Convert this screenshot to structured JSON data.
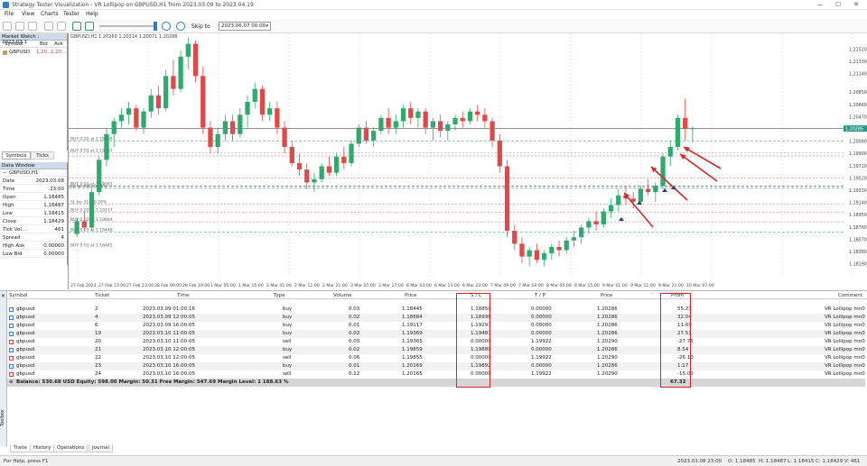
{
  "window": {
    "title": "Strategy Tester Visualization - VR Lollipop on GBPUSD,H1 from 2023.03.09 to 2023.04.19",
    "minimize": "—",
    "maximize": "☐",
    "close": "✕"
  },
  "menu": [
    "File",
    "View",
    "Charts",
    "Tester",
    "Help"
  ],
  "toolbar": {
    "skip_to_label": "Skip to",
    "skip_to_value": "2023.06.07 00:00"
  },
  "market_watch": {
    "title": "Market Watch : 2023.03.1",
    "columns": [
      "Symbol",
      "Bid",
      "Ask"
    ],
    "rows": [
      {
        "symbol": "GBPUSD",
        "bid": "1.20...",
        "ask": "1.20..."
      }
    ],
    "tabs": [
      "Symbols",
      "Ticks"
    ]
  },
  "data_window": {
    "title": "Data Window",
    "symbol": "GBPUSD,H1",
    "rows": [
      {
        "label": "Date",
        "value": "2023.03.08"
      },
      {
        "label": "Time",
        "value": "23:00"
      },
      {
        "label": "Open",
        "value": "1.18485"
      },
      {
        "label": "High",
        "value": "1.18487"
      },
      {
        "label": "Low",
        "value": "1.18415"
      },
      {
        "label": "Close",
        "value": "1.18429"
      },
      {
        "label": "Tick Vol...",
        "value": "461"
      },
      {
        "label": "Spread",
        "value": "4"
      },
      {
        "label": "High Ask",
        "value": "0.00000"
      },
      {
        "label": "Low Bid",
        "value": "0.00000"
      }
    ]
  },
  "chart": {
    "header": "GBPUSD,H1  1.20260 1.20314 1.20071 1.20286",
    "price_labels": [
      "1.21520",
      "1.21330",
      "1.21140",
      "1.20850",
      "1.20660",
      "1.20470",
      "1.20280",
      "1.20090",
      "1.19900",
      "1.19710",
      "1.19520",
      "1.19330",
      "1.19140",
      "1.18950",
      "1.18760",
      "1.18570",
      "1.18380",
      "1.18190"
    ],
    "current_price": "1.20286",
    "time_labels": [
      "27 Feb 2023",
      "27 Feb 13:00",
      "27 Feb 23:00",
      "28 Feb 09:00",
      "28 Feb 19:00",
      "1 Mar 05:00",
      "1 Mar 15:00",
      "2 Mar 01:00",
      "2 Mar 11:00",
      "2 Mar 21:00",
      "3 Mar 07:00",
      "3 Mar 17:00",
      "6 Mar 03:00",
      "6 Mar 13:00",
      "6 Mar 23:00",
      "7 Mar 09:00",
      "7 Mar 19:00",
      "8 Mar 05:00",
      "8 Mar 15:00",
      "9 Mar 01:00",
      "9 Mar 11:00",
      "9 Mar 21:00",
      "10 Mar 07:00"
    ],
    "order_labels": [
      "BUY 0.03 at 1.18448",
      "BUY 0.02 at 1.18998",
      "BUY 0.01 at 1.19297",
      "BUY 0.01 at 1.19361",
      "SL for 405, 0.34%",
      "SL for 314, 0.26%",
      "BUY 0.02 at 1.19117",
      "BUY 0.02 at 1.18684",
      "BUY 0.03 at 1.18445"
    ],
    "candles": [
      [
        1.1865,
        1.189,
        1.186,
        1.1885
      ],
      [
        1.1885,
        1.19,
        1.187,
        1.1875
      ],
      [
        1.1875,
        1.1935,
        1.187,
        1.193
      ],
      [
        1.193,
        1.1985,
        1.1925,
        1.198
      ],
      [
        1.198,
        1.203,
        1.197,
        1.202
      ],
      [
        1.202,
        1.2045,
        1.2,
        1.204
      ],
      [
        1.204,
        1.206,
        1.203,
        1.205
      ],
      [
        1.205,
        1.207,
        1.2035,
        1.206
      ],
      [
        1.206,
        1.2065,
        1.2025,
        1.203
      ],
      [
        1.203,
        1.206,
        1.202,
        1.2055
      ],
      [
        1.2055,
        1.209,
        1.2045,
        1.208
      ],
      [
        1.208,
        1.2095,
        1.205,
        1.206
      ],
      [
        1.206,
        1.212,
        1.2055,
        1.211
      ],
      [
        1.211,
        1.2135,
        1.208,
        1.209
      ],
      [
        1.209,
        1.215,
        1.2085,
        1.214
      ],
      [
        1.214,
        1.217,
        1.212,
        1.216
      ],
      [
        1.216,
        1.2165,
        1.21,
        1.211
      ],
      [
        1.211,
        1.2125,
        1.202,
        1.203
      ],
      [
        1.203,
        1.204,
        1.199,
        1.2
      ],
      [
        1.2,
        1.203,
        1.199,
        1.202
      ],
      [
        1.202,
        1.205,
        1.201,
        1.204
      ],
      [
        1.204,
        1.205,
        1.201,
        1.202
      ],
      [
        1.202,
        1.206,
        1.2015,
        1.205
      ],
      [
        1.205,
        1.208,
        1.203,
        1.207
      ],
      [
        1.207,
        1.21,
        1.206,
        1.209
      ],
      [
        1.209,
        1.2095,
        1.204,
        1.205
      ],
      [
        1.205,
        1.207,
        1.204,
        1.206
      ],
      [
        1.206,
        1.207,
        1.202,
        1.203
      ],
      [
        1.203,
        1.204,
        1.199,
        1.2
      ],
      [
        1.2,
        1.201,
        1.197,
        1.1975
      ],
      [
        1.1975,
        1.199,
        1.1955,
        1.1965
      ],
      [
        1.1965,
        1.1975,
        1.1935,
        1.1945
      ],
      [
        1.1945,
        1.196,
        1.193,
        1.195
      ],
      [
        1.195,
        1.1975,
        1.1945,
        1.197
      ],
      [
        1.197,
        1.1985,
        1.1955,
        1.196
      ],
      [
        1.196,
        1.199,
        1.1955,
        1.1985
      ],
      [
        1.1985,
        1.2,
        1.1965,
        1.1975
      ],
      [
        1.1975,
        1.201,
        1.197,
        1.2005
      ],
      [
        1.2005,
        1.2035,
        1.2,
        1.203
      ],
      [
        1.203,
        1.204,
        1.2005,
        1.201
      ],
      [
        1.201,
        1.203,
        1.2,
        1.2025
      ],
      [
        1.2025,
        1.205,
        1.202,
        1.2045
      ],
      [
        1.2045,
        1.206,
        1.202,
        1.203
      ],
      [
        1.203,
        1.205,
        1.202,
        1.204
      ],
      [
        1.204,
        1.2065,
        1.203,
        1.206
      ],
      [
        1.206,
        1.207,
        1.2035,
        1.2045
      ],
      [
        1.2045,
        1.206,
        1.203,
        1.2055
      ],
      [
        1.2055,
        1.206,
        1.202,
        1.203
      ],
      [
        1.203,
        1.2045,
        1.201,
        1.204
      ],
      [
        1.204,
        1.205,
        1.2015,
        1.2025
      ],
      [
        1.2025,
        1.204,
        1.201,
        1.2035
      ],
      [
        1.2035,
        1.205,
        1.2025,
        1.2045
      ],
      [
        1.2045,
        1.2055,
        1.203,
        1.204
      ],
      [
        1.204,
        1.206,
        1.2035,
        1.2055
      ],
      [
        1.2055,
        1.2065,
        1.204,
        1.205
      ],
      [
        1.205,
        1.206,
        1.203,
        1.204
      ],
      [
        1.204,
        1.2045,
        1.2,
        1.201
      ],
      [
        1.201,
        1.202,
        1.196,
        1.197
      ],
      [
        1.197,
        1.198,
        1.186,
        1.187
      ],
      [
        1.187,
        1.188,
        1.184,
        1.185
      ],
      [
        1.185,
        1.186,
        1.182,
        1.183
      ],
      [
        1.183,
        1.1845,
        1.1815,
        1.184
      ],
      [
        1.184,
        1.185,
        1.182,
        1.1825
      ],
      [
        1.1825,
        1.184,
        1.1815,
        1.1835
      ],
      [
        1.1835,
        1.185,
        1.1825,
        1.1845
      ],
      [
        1.1845,
        1.1855,
        1.183,
        1.184
      ],
      [
        1.184,
        1.186,
        1.1835,
        1.1855
      ],
      [
        1.1855,
        1.187,
        1.1845,
        1.186
      ],
      [
        1.186,
        1.188,
        1.185,
        1.1875
      ],
      [
        1.1875,
        1.189,
        1.1865,
        1.1885
      ],
      [
        1.1885,
        1.19,
        1.187,
        1.188
      ],
      [
        1.188,
        1.1905,
        1.1875,
        1.19
      ],
      [
        1.19,
        1.192,
        1.189,
        1.191
      ],
      [
        1.191,
        1.1935,
        1.19,
        1.1925
      ],
      [
        1.1925,
        1.194,
        1.191,
        1.192
      ],
      [
        1.192,
        1.193,
        1.1905,
        1.1915
      ],
      [
        1.1915,
        1.194,
        1.191,
        1.1935
      ],
      [
        1.1935,
        1.195,
        1.1925,
        1.193
      ],
      [
        1.193,
        1.1945,
        1.1915,
        1.194
      ],
      [
        1.194,
        1.199,
        1.1935,
        1.1985
      ],
      [
        1.1985,
        1.201,
        1.197,
        1.2
      ],
      [
        1.2,
        1.205,
        1.1995,
        1.2045
      ],
      [
        1.2045,
        1.2075,
        1.201,
        1.2028
      ],
      [
        1.2028,
        1.2032,
        1.2007,
        1.2029
      ]
    ]
  },
  "trades": {
    "columns": [
      "Symbol",
      "Ticket",
      "Time",
      "Type",
      "Volume",
      "Price",
      "S / L",
      "T / P",
      "Price",
      "Profit",
      "Comment"
    ],
    "rows": [
      {
        "symbol": "gbpusd",
        "ticket": "2",
        "time": "2023.03.09 01:00:16",
        "type": "buy",
        "volume": "0.03",
        "price": "1.18445",
        "sl": "1.18850",
        "tp": "0.00000",
        "cur": "1.20286",
        "profit": "55.23",
        "comment": "VR Lollipop mn0"
      },
      {
        "symbol": "gbpusd",
        "ticket": "4",
        "time": "2023.03.09 12:00:05",
        "type": "buy",
        "volume": "0.02",
        "price": "1.18684",
        "sl": "1.18998",
        "tp": "0.00000",
        "cur": "1.20286",
        "profit": "32.04",
        "comment": "VR Lollipop mn0"
      },
      {
        "symbol": "gbpusd",
        "ticket": "6",
        "time": "2023.03.09 16:00:05",
        "type": "buy",
        "volume": "0.01",
        "price": "1.19117",
        "sl": "1.19297",
        "tp": "0.00000",
        "cur": "1.20286",
        "profit": "11.69",
        "comment": "VR Lollipop mn0"
      },
      {
        "symbol": "gbpusd",
        "ticket": "19",
        "time": "2023.03.10 11:00:05",
        "type": "buy",
        "volume": "0.03",
        "price": "1.19369",
        "sl": "1.19487",
        "tp": "0.00000",
        "cur": "1.20286",
        "profit": "27.51",
        "comment": "VR Lollipop mn0"
      },
      {
        "symbol": "gbpusd",
        "ticket": "20",
        "time": "2023.03.10 11:00:05",
        "type": "sell",
        "volume": "0.03",
        "price": "1.19365",
        "sl": "0.00000",
        "tp": "1.19922",
        "cur": "1.20290",
        "profit": "-27.75",
        "comment": "VR Lollipop mn0"
      },
      {
        "symbol": "gbpusd",
        "ticket": "21",
        "time": "2023.03.10 12:00:05",
        "type": "buy",
        "volume": "0.02",
        "price": "1.19859",
        "sl": "1.19880",
        "tp": "0.00000",
        "cur": "1.20286",
        "profit": "8.54",
        "comment": "VR Lollipop mn0"
      },
      {
        "symbol": "gbpusd",
        "ticket": "22",
        "time": "2023.03.10 12:00:05",
        "type": "sell",
        "volume": "0.06",
        "price": "1.19855",
        "sl": "0.00000",
        "tp": "1.19922",
        "cur": "1.20290",
        "profit": "-26.10",
        "comment": "VR Lollipop mn0"
      },
      {
        "symbol": "gbpusd",
        "ticket": "23",
        "time": "2023.03.10 16:00:05",
        "type": "buy",
        "volume": "0.01",
        "price": "1.20169",
        "sl": "1.19892",
        "tp": "0.00000",
        "cur": "1.20286",
        "profit": "1.17",
        "comment": "VR Lollipop mn0"
      },
      {
        "symbol": "gbpusd",
        "ticket": "24",
        "time": "2023.03.10 16:00:05",
        "type": "sell",
        "volume": "0.12",
        "price": "1.20165",
        "sl": "0.00000",
        "tp": "1.19922",
        "cur": "1.20290",
        "profit": "-15.00",
        "comment": "VR Lollipop mn0"
      }
    ],
    "summary": "Balance: 530.68 USD  Equity: 598.00  Margin: 50.31  Free Margin: 547.69  Margin Level: 1 188.63 %",
    "total_profit": "67.32",
    "side_label": "Toolbox"
  },
  "bottom_tabs": [
    "Trade",
    "History",
    "Operations",
    "Journal"
  ],
  "statusbar": {
    "help": "For Help, press F1",
    "datetime": "2023.03.08 23:00",
    "open": "O: 1.18485",
    "high": "H: 1.18487",
    "low": "L: 1.18415",
    "close": "C: 1.18429",
    "volume": "V: 461"
  },
  "colors": {
    "bull": "#2eaa6e",
    "bear": "#e14848",
    "highlight_box": "#d62828",
    "arrow": "#d62828",
    "panel_header": "#cfdce9"
  }
}
